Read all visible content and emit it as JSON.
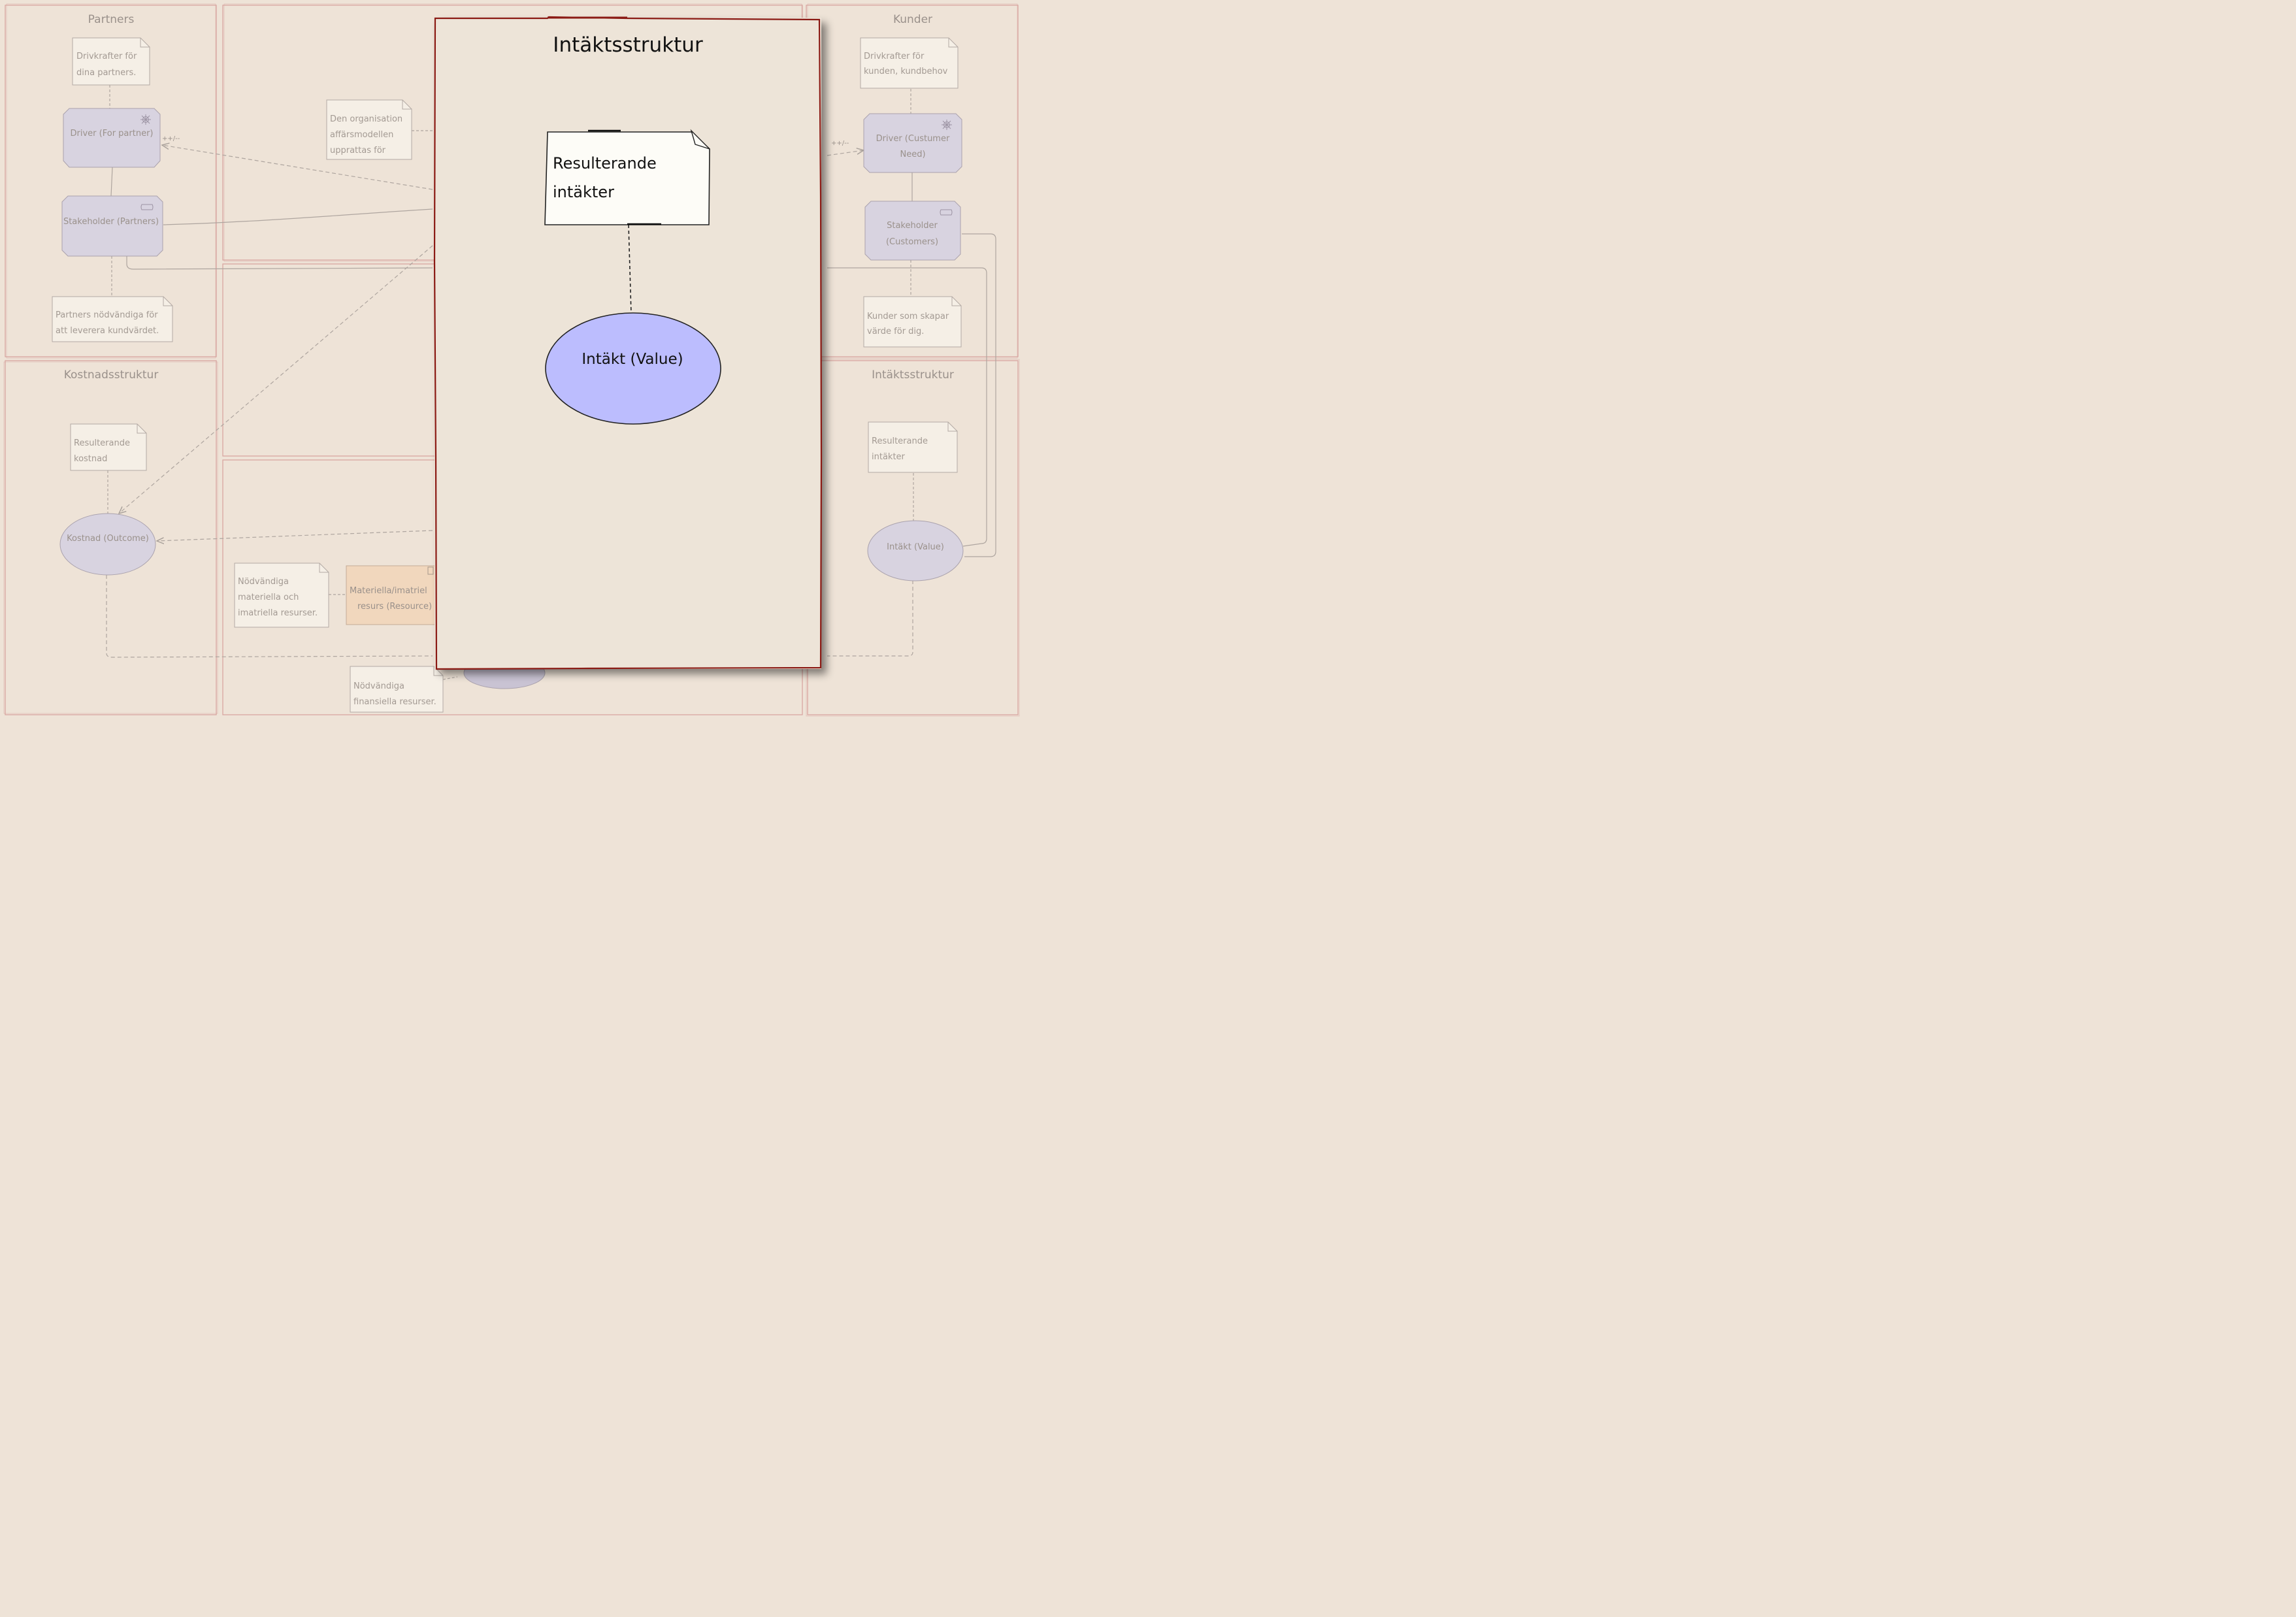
{
  "zones": {
    "partners": "Partners",
    "kunder": "Kunder",
    "kostnadsstruktur": "Kostnadsstruktur",
    "intaktsstruktur": "Intäktsstruktur"
  },
  "partners": {
    "note_top": [
      "Drivkrafter för",
      "dina partners."
    ],
    "driver": [
      "Driver (For partner)"
    ],
    "stakeholder": [
      "Stakeholder (Partners)"
    ],
    "note_bottom": [
      "Partners nödvändiga för",
      "att leverera kundvärdet."
    ],
    "driver_edge_label": "++/--"
  },
  "center": {
    "org_note": [
      "Den organisation",
      "affärsmodellen",
      "upprattas för"
    ],
    "resources_note": [
      "Nödvändiga",
      "materiella och",
      "imatriella resurser."
    ],
    "resource": [
      "Materiella/imatriel",
      "resurs (Resource)"
    ],
    "finance_note": [
      "Nödvändiga",
      "finansiella resurser."
    ]
  },
  "kunder": {
    "note_top": [
      "Drivkrafter för",
      "kunden, kundbehov"
    ],
    "driver": [
      "Driver (Custumer",
      "Need)"
    ],
    "stakeholder": [
      "Stakeholder",
      "(Customers)"
    ],
    "note_bottom": [
      "Kunder som skapar",
      "värde för dig."
    ],
    "driver_edge_label": "++/--"
  },
  "kostnad": {
    "note": [
      "Resulterande",
      "kostnad"
    ],
    "outcome": "Kostnad (Outcome)"
  },
  "intakt": {
    "note": [
      "Resulterande",
      "intäkter"
    ],
    "value": "Intäkt (Value)"
  },
  "popup": {
    "title": "Intäktsstruktur",
    "note": [
      "Resulterande",
      "intäkter"
    ],
    "value": "Intäkt (Value)"
  },
  "colors": {
    "background": "#eee3d7",
    "zone_border": "#d8a6a0",
    "node_fill": "#d8d3e0",
    "popup_border": "#8b1a14",
    "popup_fill": "#ede4d8",
    "value_fill": "#bcbdfe",
    "resource_fill": "#f1d7bd"
  }
}
